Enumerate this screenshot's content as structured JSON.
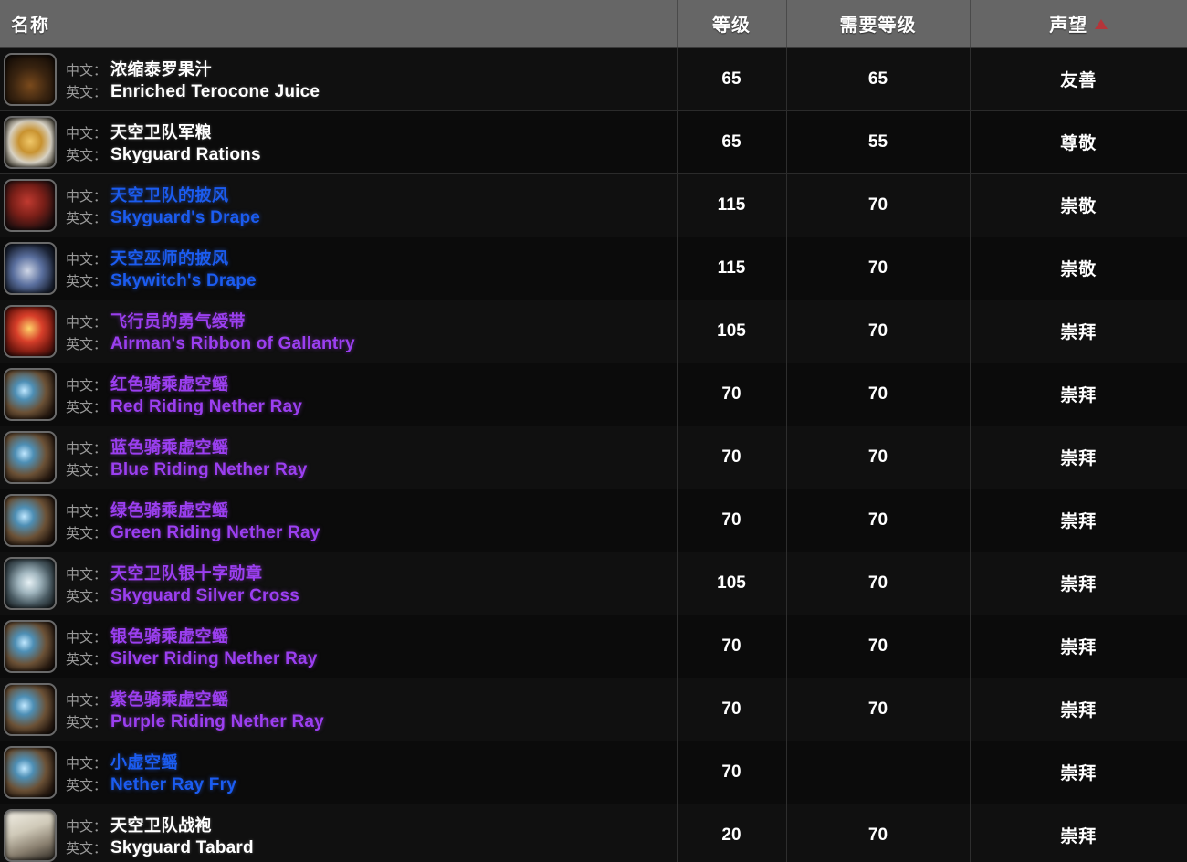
{
  "table": {
    "columns": [
      {
        "key": "name",
        "label": "名称",
        "align": "left",
        "sorted": false
      },
      {
        "key": "level",
        "label": "等级",
        "align": "center",
        "sorted": false
      },
      {
        "key": "req",
        "label": "需要等级",
        "align": "center",
        "sorted": false
      },
      {
        "key": "rep",
        "label": "声望",
        "align": "center",
        "sorted": true
      }
    ],
    "sort_indicator": {
      "icon": "sort-ascending-triangle-icon",
      "direction": "asc",
      "color": "#b4353a"
    },
    "lang_labels": {
      "cn": "中文：",
      "en": "英文："
    },
    "quality_colors": {
      "common": "#ffffff",
      "rare": "#1b5cf0",
      "epic": "#9b3ff0"
    },
    "rows": [
      {
        "icon": "item-icon-enriched-terocone-juice",
        "icon_style": "ic-juice",
        "icon_glyph": "",
        "name_cn": "浓缩泰罗果汁",
        "name_en": "Enriched Terocone Juice",
        "quality": "common",
        "level": "65",
        "req": "65",
        "rep": "友善"
      },
      {
        "icon": "item-icon-skyguard-rations",
        "icon_style": "ic-rations",
        "icon_glyph": "",
        "name_cn": "天空卫队军粮",
        "name_en": "Skyguard Rations",
        "quality": "common",
        "level": "65",
        "req": "55",
        "rep": "尊敬"
      },
      {
        "icon": "item-icon-skyguards-drape",
        "icon_style": "ic-drape-r",
        "icon_glyph": "",
        "name_cn": "天空卫队的披风",
        "name_en": "Skyguard's Drape",
        "quality": "rare",
        "level": "115",
        "req": "70",
        "rep": "崇敬"
      },
      {
        "icon": "item-icon-skywitchs-drape",
        "icon_style": "ic-drape-b",
        "icon_glyph": "",
        "name_cn": "天空巫师的披风",
        "name_en": "Skywitch's Drape",
        "quality": "rare",
        "level": "115",
        "req": "70",
        "rep": "崇敬"
      },
      {
        "icon": "item-icon-airmans-ribbon-of-gallantry",
        "icon_style": "ic-ribbon",
        "icon_glyph": "",
        "name_cn": "飞行员的勇气绶带",
        "name_en": "Airman's Ribbon of Gallantry",
        "quality": "epic",
        "level": "105",
        "req": "70",
        "rep": "崇拜"
      },
      {
        "icon": "item-icon-red-riding-nether-ray",
        "icon_style": "ic-ray",
        "icon_glyph": "",
        "name_cn": "红色骑乘虚空鳐",
        "name_en": "Red Riding Nether Ray",
        "quality": "epic",
        "level": "70",
        "req": "70",
        "rep": "崇拜"
      },
      {
        "icon": "item-icon-blue-riding-nether-ray",
        "icon_style": "ic-ray",
        "icon_glyph": "",
        "name_cn": "蓝色骑乘虚空鳐",
        "name_en": "Blue Riding Nether Ray",
        "quality": "epic",
        "level": "70",
        "req": "70",
        "rep": "崇拜"
      },
      {
        "icon": "item-icon-green-riding-nether-ray",
        "icon_style": "ic-ray",
        "icon_glyph": "",
        "name_cn": "绿色骑乘虚空鳐",
        "name_en": "Green Riding Nether Ray",
        "quality": "epic",
        "level": "70",
        "req": "70",
        "rep": "崇拜"
      },
      {
        "icon": "item-icon-skyguard-silver-cross",
        "icon_style": "ic-cross",
        "icon_glyph": "",
        "name_cn": "天空卫队银十字勋章",
        "name_en": "Skyguard Silver Cross",
        "quality": "epic",
        "level": "105",
        "req": "70",
        "rep": "崇拜"
      },
      {
        "icon": "item-icon-silver-riding-nether-ray",
        "icon_style": "ic-ray",
        "icon_glyph": "",
        "name_cn": "银色骑乘虚空鳐",
        "name_en": "Silver Riding Nether Ray",
        "quality": "epic",
        "level": "70",
        "req": "70",
        "rep": "崇拜"
      },
      {
        "icon": "item-icon-purple-riding-nether-ray",
        "icon_style": "ic-ray",
        "icon_glyph": "",
        "name_cn": "紫色骑乘虚空鳐",
        "name_en": "Purple Riding Nether Ray",
        "quality": "epic",
        "level": "70",
        "req": "70",
        "rep": "崇拜"
      },
      {
        "icon": "item-icon-nether-ray-fry",
        "icon_style": "ic-ray",
        "icon_glyph": "",
        "name_cn": "小虚空鳐",
        "name_en": "Nether Ray Fry",
        "quality": "rare",
        "level": "70",
        "req": "",
        "rep": "崇拜"
      },
      {
        "icon": "item-icon-skyguard-tabard",
        "icon_style": "ic-tabard",
        "icon_glyph": "",
        "name_cn": "天空卫队战袍",
        "name_en": "Skyguard Tabard",
        "quality": "common",
        "level": "20",
        "req": "70",
        "rep": "崇拜"
      }
    ]
  }
}
